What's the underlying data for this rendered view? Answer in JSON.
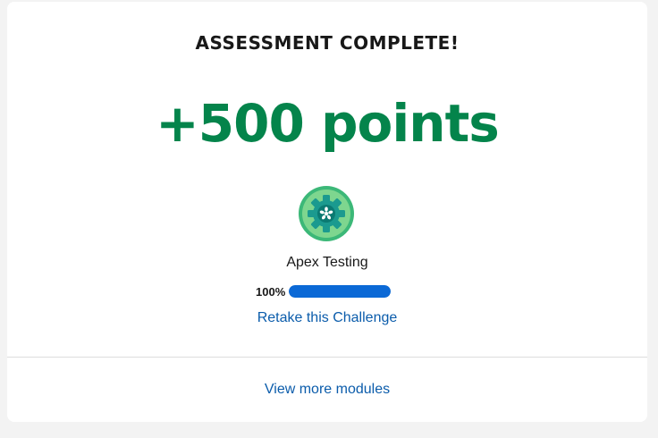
{
  "card": {
    "title": "ASSESSMENT COMPLETE!",
    "points": "+500 points",
    "badge": {
      "icon": "gear-badge-icon",
      "colors": {
        "ring": "#3cb878",
        "outer_fill": "#7ed68f",
        "gear": "#1b9a8f",
        "center": "#0b7a72"
      }
    },
    "module_name": "Apex Testing",
    "progress": {
      "label": "100%",
      "value": 1.0,
      "color": "#0b69d6"
    },
    "retake_label": "Retake this Challenge",
    "more_modules_label": "View more modules"
  },
  "colors": {
    "points_green": "#04844b",
    "link_blue": "#0b5cab"
  }
}
